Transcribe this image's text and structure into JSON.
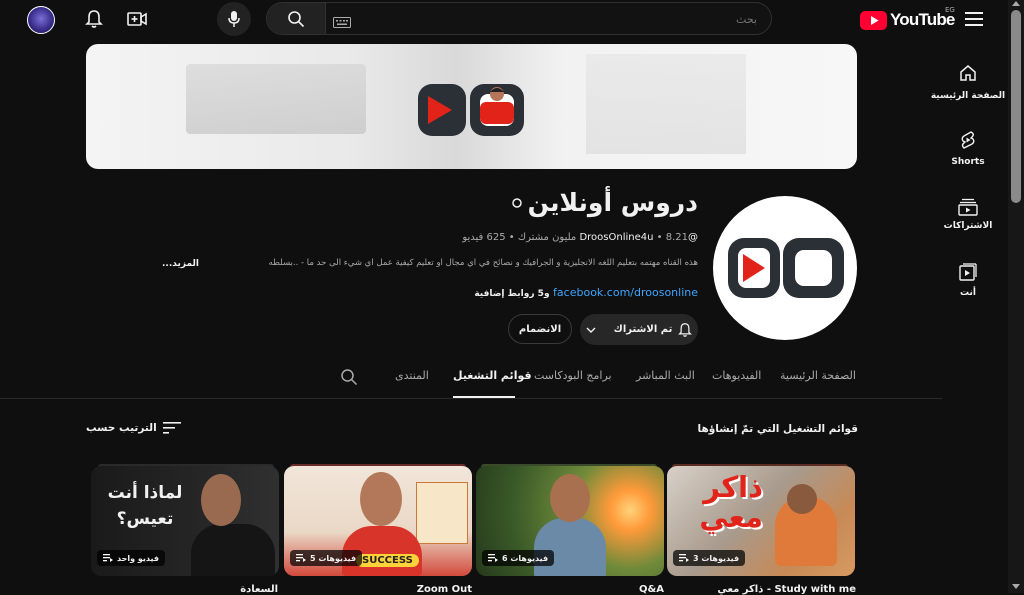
{
  "topbar": {
    "brand": "YouTube",
    "country": "EG",
    "search_placeholder": "بحث"
  },
  "sidebar": {
    "items": [
      {
        "label": "الصفحة الرئيسية",
        "icon": "home-icon"
      },
      {
        "label": "Shorts",
        "icon": "shorts-icon"
      },
      {
        "label": "الاشتراكات",
        "icon": "subscriptions-icon"
      },
      {
        "label": "أنت",
        "icon": "you-icon"
      }
    ]
  },
  "channel": {
    "name": "دروس أونلاين",
    "handle": "@DroosOnline4u",
    "subscribers": "8.21 مليون مشترك",
    "videos": "625 فيديو",
    "description": "هذه القناه مهتمه بتعليم اللغه الانجليزية و الجرافيك و نصائح في اي مجال او تعليم كيفية عمل اي شيء الى حد ما - ..بسلطه",
    "more": "...المزيد",
    "link": "facebook.com/droosonline",
    "link_extra": "و5 روابط إضافية",
    "subscribe_label": "تم الاشتراك",
    "join_label": "الانضمام"
  },
  "tabs": [
    {
      "label": "الصفحة الرئيسية",
      "active": false
    },
    {
      "label": "الفيديوهات",
      "active": false
    },
    {
      "label": "البث المباشر",
      "active": false
    },
    {
      "label": "برامج البودكاست",
      "active": false
    },
    {
      "label": "قوائم التشغيل",
      "active": true
    },
    {
      "label": "المنتدى",
      "active": false
    }
  ],
  "section": {
    "title": "قوائم التشغيل التي تمّ إنشاؤها",
    "sort_label": "الترتيب حسب"
  },
  "playlists": [
    {
      "count": "3 فيديوهات",
      "title": "Study with me - ذاكر معي",
      "thumb_text": "ذاكر معي",
      "color": "#8a2a1e"
    },
    {
      "count": "6 فيديوهات",
      "title": "Q&A",
      "thumb_text": "",
      "color": "#3d6a2a"
    },
    {
      "count": "5 فيديوهات",
      "title": "Zoom Out",
      "thumb_text": "SUCCESS",
      "color": "#c83a32"
    },
    {
      "count": "فيديو واحد",
      "title": "السعادة",
      "thumb_text": "لماذا أنت تعيس؟",
      "color": "#1c1c1c"
    }
  ],
  "colors": {
    "brand_red": "#ff0033",
    "background": "#0f0f0f",
    "link_blue": "#3ea6ff"
  }
}
